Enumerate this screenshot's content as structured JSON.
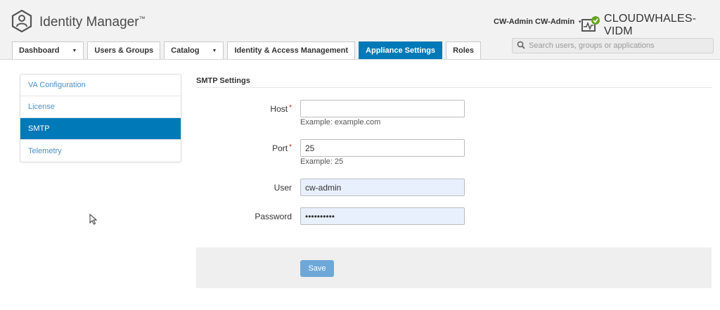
{
  "app": {
    "name": "Identity Manager",
    "trademark": "™"
  },
  "user": {
    "name": "CW-Admin CW-Admin",
    "caret": "▾"
  },
  "tenant": {
    "name": "CLOUDWHALES-VIDM"
  },
  "tabs": [
    {
      "label": "Dashboard",
      "has_caret": true
    },
    {
      "label": "Users & Groups"
    },
    {
      "label": "Catalog",
      "has_caret": true
    },
    {
      "label": "Identity & Access Management"
    },
    {
      "label": "Appliance Settings",
      "active": true
    },
    {
      "label": "Roles"
    }
  ],
  "search": {
    "placeholder": "Search users, groups or applications"
  },
  "sidebar": {
    "items": [
      {
        "label": "VA Configuration"
      },
      {
        "label": "License"
      },
      {
        "label": "SMTP",
        "active": true
      },
      {
        "label": "Telemetry"
      }
    ]
  },
  "smtp": {
    "title": "SMTP Settings",
    "host": {
      "label": "Host",
      "required_mark": "*",
      "value": "",
      "help": "Example: example.com"
    },
    "port": {
      "label": "Port",
      "required_mark": "*",
      "value": "25",
      "help": "Example: 25"
    },
    "user": {
      "label": "User",
      "value": "cw-admin"
    },
    "password": {
      "label": "Password",
      "value": "••••••••••"
    },
    "save_label": "Save"
  },
  "colors": {
    "accent": "#0079b8",
    "link": "#4a90c7",
    "save_button": "#6ea8d8",
    "autofill": "#e8f0fe"
  }
}
